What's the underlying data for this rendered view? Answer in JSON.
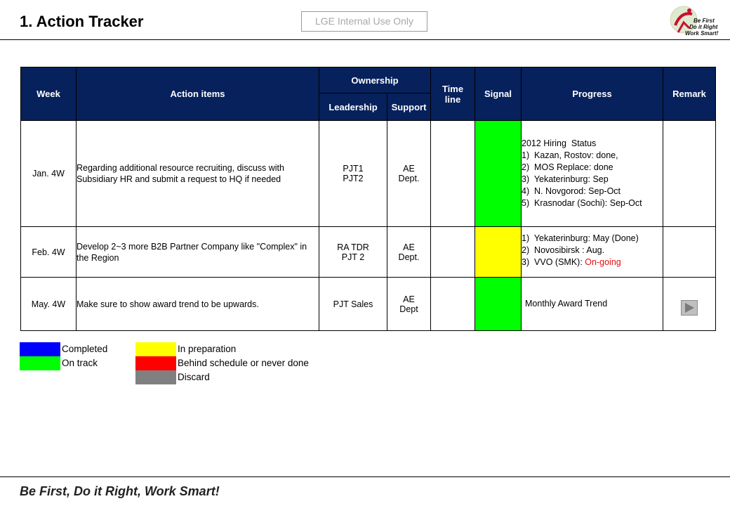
{
  "header": {
    "title": "1. Action Tracker",
    "classification": "LGE Internal Use Only",
    "logo_lines": [
      "Be First",
      "Do it Right",
      "Work Smart!"
    ]
  },
  "table": {
    "headers": {
      "week": "Week",
      "action_items": "Action items",
      "ownership": "Ownership",
      "leadership": "Leadership",
      "support": "Support",
      "timeline_line1": "Time",
      "timeline_line2": "line",
      "signal": "Signal",
      "progress": "Progress",
      "remark": "Remark"
    },
    "rows": [
      {
        "week": "Jan. 4W",
        "action": "Regarding additional resource recruiting, discuss with Subsidiary HR and submit a request to HQ if needed",
        "leadership": [
          "PJT1",
          "PJT2"
        ],
        "support": [
          "AE",
          "Dept."
        ],
        "timeline": "",
        "signal": "green",
        "progress": [
          "2012 Hiring  Status",
          "1)  Kazan, Rostov: done,",
          "2)  MOS Replace: done",
          "3)  Yekaterinburg: Sep",
          "4)  N. Novgorod: Sep-Oct",
          "5)  Krasnodar (Sochi): Sep-Oct"
        ]
      },
      {
        "week": "Feb. 4W",
        "action": "Develop 2~3 more B2B Partner Company like \"Complex\" in the Region",
        "leadership": [
          "RA TDR",
          "PJT 2"
        ],
        "support": [
          "AE",
          "Dept."
        ],
        "timeline": "",
        "signal": "yellow",
        "progress": [
          "1)  Yekaterinburg: May (Done)",
          "2)  Novosibirsk : Aug.",
          "3)  VVO (SMK): "
        ],
        "progress_status": "On-going"
      },
      {
        "week": "May. 4W",
        "action": "Make sure to show award trend to be upwards.",
        "leadership": [
          "PJT Sales"
        ],
        "support": [
          "AE",
          "Dept"
        ],
        "timeline": "",
        "signal": "green",
        "progress": [
          "Monthly Award Trend"
        ],
        "remark_icon": "play-icon"
      }
    ]
  },
  "legend": [
    {
      "label": "Completed",
      "color": "#0000ff"
    },
    {
      "label": "On track",
      "color": "#00ff00"
    },
    {
      "label": "In preparation",
      "color": "#ffff00"
    },
    {
      "label": "Behind schedule or never done",
      "color": "#ff0000"
    },
    {
      "label": "Discard",
      "color": "#808080"
    }
  ],
  "footer": {
    "slogan": "Be First, Do it Right, Work Smart!"
  },
  "colors": {
    "header_bg": "#06215c",
    "signal_green": "#00ff00",
    "signal_yellow": "#ffff00",
    "ongoing_text": "#e01010"
  }
}
